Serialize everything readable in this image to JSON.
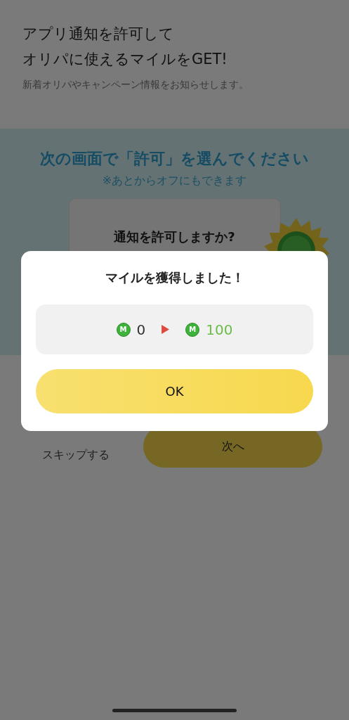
{
  "header": {
    "title_lines": [
      "アプリ通知を許可して",
      "オリパに使えるマイルをGET!"
    ],
    "subtitle": "新着オリパやキャンペーン情報をお知らせします。"
  },
  "guide": {
    "heading": "次の画面で「許可」を選んでください",
    "note": "※あとからオフにもできます",
    "prompt_title": "通知を許可しますか?"
  },
  "actions": {
    "skip": "スキップする",
    "next": "次へ"
  },
  "modal": {
    "title": "マイルを獲得しました！",
    "amounts": [
      {
        "mark": "M",
        "value": "0",
        "kind": "before"
      },
      {
        "mark": "M",
        "value": "100",
        "kind": "after"
      }
    ],
    "ok": "OK"
  }
}
